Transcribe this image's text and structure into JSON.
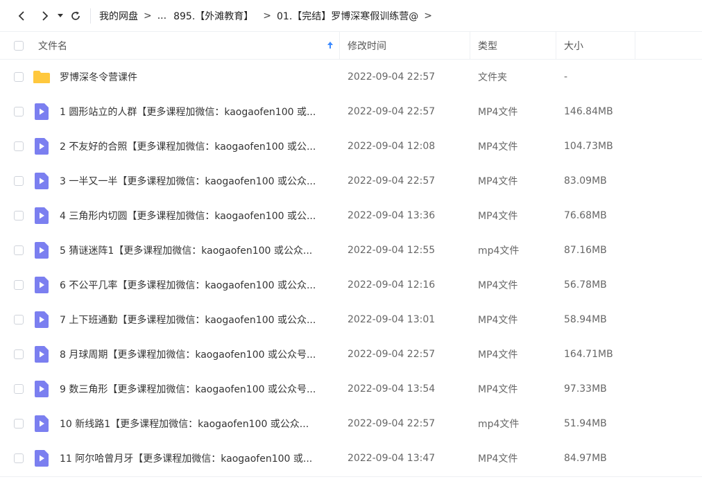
{
  "breadcrumb": [
    "我的网盘",
    "...",
    "895.【外滩教育】",
    "01.【完结】罗博深寒假训练营@"
  ],
  "columns": {
    "name": "文件名",
    "time": "修改时间",
    "type": "类型",
    "size": "大小"
  },
  "colors": {
    "folder": "#ffc83d",
    "video": "#7b7ff0",
    "sort_arrow": "#3d8bff"
  },
  "files": [
    {
      "icon": "folder-icon",
      "name": "罗博深冬令营课件",
      "time": "2022-09-04 22:57",
      "type": "文件夹",
      "size": "-"
    },
    {
      "icon": "video-file-icon",
      "name": "1 圆形站立的人群【更多课程加微信：kaogaofen100 或...",
      "time": "2022-09-04 22:57",
      "type": "MP4文件",
      "size": "146.84MB"
    },
    {
      "icon": "video-file-icon",
      "name": "2 不友好的合照【更多课程加微信：kaogaofen100 或公...",
      "time": "2022-09-04 12:08",
      "type": "MP4文件",
      "size": "104.73MB"
    },
    {
      "icon": "video-file-icon",
      "name": "3 一半又一半【更多课程加微信：kaogaofen100 或公众...",
      "time": "2022-09-04 22:57",
      "type": "MP4文件",
      "size": "83.09MB"
    },
    {
      "icon": "video-file-icon",
      "name": "4 三角形内切圆【更多课程加微信：kaogaofen100 或公...",
      "time": "2022-09-04 13:36",
      "type": "MP4文件",
      "size": "76.68MB"
    },
    {
      "icon": "video-file-icon",
      "name": "5 猜谜迷阵1【更多课程加微信：kaogaofen100 或公众...",
      "time": "2022-09-04 12:55",
      "type": "mp4文件",
      "size": "87.16MB"
    },
    {
      "icon": "video-file-icon",
      "name": "6 不公平几率【更多课程加微信：kaogaofen100 或公众...",
      "time": "2022-09-04 12:16",
      "type": "MP4文件",
      "size": "56.78MB"
    },
    {
      "icon": "video-file-icon",
      "name": "7 上下班通勤【更多课程加微信：kaogaofen100 或公众...",
      "time": "2022-09-04 13:01",
      "type": "MP4文件",
      "size": "58.94MB"
    },
    {
      "icon": "video-file-icon",
      "name": "8 月球周期【更多课程加微信：kaogaofen100 或公众号...",
      "time": "2022-09-04 22:57",
      "type": "MP4文件",
      "size": "164.71MB"
    },
    {
      "icon": "video-file-icon",
      "name": "9 数三角形【更多课程加微信：kaogaofen100 或公众号...",
      "time": "2022-09-04 13:54",
      "type": "MP4文件",
      "size": "97.33MB"
    },
    {
      "icon": "video-file-icon",
      "name": "10 新线路1【更多课程加微信：kaogaofen100 或公众...",
      "time": "2022-09-04 22:57",
      "type": "mp4文件",
      "size": "51.94MB"
    },
    {
      "icon": "video-file-icon",
      "name": "11 阿尔哈曾月牙【更多课程加微信：kaogaofen100 或...",
      "time": "2022-09-04 13:47",
      "type": "MP4文件",
      "size": "84.97MB"
    }
  ]
}
